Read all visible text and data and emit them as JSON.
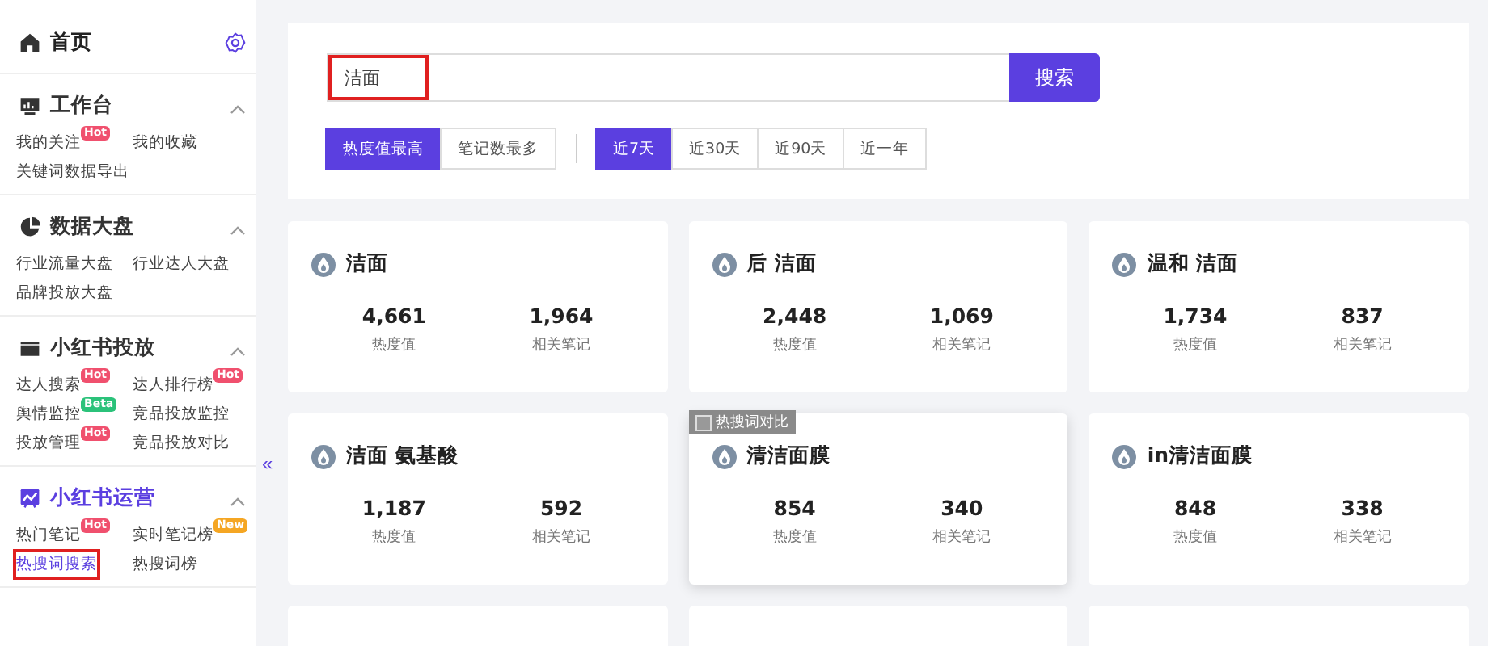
{
  "sidebar": {
    "home": {
      "label": "首页"
    },
    "sections": [
      {
        "title": "工作台",
        "expanded": true,
        "active": false,
        "items": [
          {
            "label": "我的关注",
            "badge": "Hot",
            "color": "#f0506e",
            "selected": false,
            "highlighted": false
          },
          {
            "label": "我的收藏",
            "selected": false,
            "highlighted": false
          },
          {
            "label": "关键词数据导出",
            "selected": false,
            "highlighted": false
          }
        ]
      },
      {
        "title": "数据大盘",
        "expanded": true,
        "active": false,
        "items": [
          {
            "label": "行业流量大盘",
            "selected": false,
            "highlighted": false
          },
          {
            "label": "行业达人大盘",
            "selected": false,
            "highlighted": false
          },
          {
            "label": "品牌投放大盘",
            "selected": false,
            "highlighted": false
          }
        ]
      },
      {
        "title": "小红书投放",
        "expanded": true,
        "active": false,
        "items": [
          {
            "label": "达人搜索",
            "badge": "Hot",
            "color": "#f0506e",
            "selected": false,
            "highlighted": false
          },
          {
            "label": "达人排行榜",
            "badge": "Hot",
            "color": "#f0506e",
            "selected": false,
            "highlighted": false
          },
          {
            "label": "舆情监控",
            "badge": "Beta",
            "color": "#2bc27a",
            "selected": false,
            "highlighted": false
          },
          {
            "label": "竞品投放监控",
            "selected": false,
            "highlighted": false
          },
          {
            "label": "投放管理",
            "badge": "Hot",
            "color": "#f0506e",
            "selected": false,
            "highlighted": false
          },
          {
            "label": "竞品投放对比",
            "selected": false,
            "highlighted": false
          }
        ]
      },
      {
        "title": "小红书运营",
        "expanded": true,
        "active": true,
        "items": [
          {
            "label": "热门笔记",
            "badge": "Hot",
            "color": "#f0506e",
            "selected": false,
            "highlighted": false
          },
          {
            "label": "实时笔记榜",
            "badge": "New",
            "color": "#f5a623",
            "selected": false,
            "highlighted": false
          },
          {
            "label": "热搜词搜索",
            "selected": true,
            "highlighted": true
          },
          {
            "label": "热搜词榜",
            "selected": false,
            "highlighted": false
          }
        ]
      }
    ]
  },
  "collapse": {
    "label": "«"
  },
  "search": {
    "value": "洁面",
    "highlighted": true,
    "button": "搜索"
  },
  "sort_tabs": [
    {
      "label": "热度值最高",
      "selected": true
    },
    {
      "label": "笔记数最多",
      "selected": false
    }
  ],
  "range_tabs": [
    {
      "label": "近7天",
      "selected": true
    },
    {
      "label": "近30天",
      "selected": false
    },
    {
      "label": "近90天",
      "selected": false
    },
    {
      "label": "近一年",
      "selected": false
    }
  ],
  "cards": [
    {
      "title": "洁面",
      "heat": "4,661",
      "heat_label": "热度值",
      "notes": "1,964",
      "notes_label": "相关笔记",
      "hovered": false
    },
    {
      "title": "后 洁面",
      "heat": "2,448",
      "heat_label": "热度值",
      "notes": "1,069",
      "notes_label": "相关笔记",
      "hovered": false
    },
    {
      "title": "温和 洁面",
      "heat": "1,734",
      "heat_label": "热度值",
      "notes": "837",
      "notes_label": "相关笔记",
      "hovered": false
    },
    {
      "title": "洁面 氨基酸",
      "heat": "1,187",
      "heat_label": "热度值",
      "notes": "592",
      "notes_label": "相关笔记",
      "hovered": false
    },
    {
      "title": "清洁面膜",
      "heat": "854",
      "heat_label": "热度值",
      "notes": "340",
      "notes_label": "相关笔记",
      "hovered": true,
      "compare": {
        "label": "热搜词对比",
        "checked": false
      }
    },
    {
      "title": "in清洁面膜",
      "heat": "848",
      "heat_label": "热度值",
      "notes": "338",
      "notes_label": "相关笔记",
      "hovered": false
    }
  ]
}
